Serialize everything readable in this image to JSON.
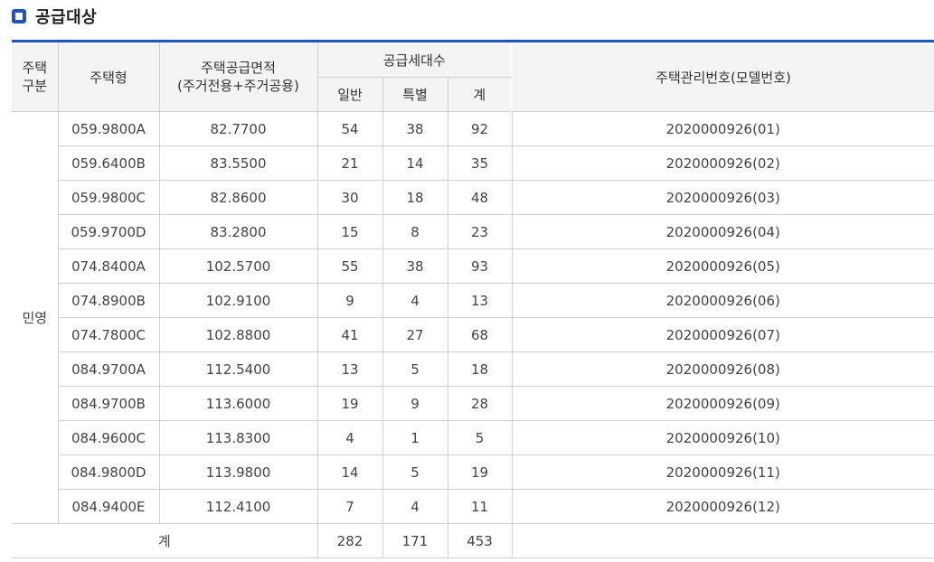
{
  "section_title": "공급대상",
  "headers": {
    "house_category": [
      "주택",
      "구분"
    ],
    "house_type": "주택형",
    "area": [
      "주택공급면적",
      "(주거전용+주거공용)"
    ],
    "supply_count": "공급세대수",
    "general": "일반",
    "special": "특별",
    "total": "계",
    "management_no": "주택관리번호(모델번호)"
  },
  "category": "민영",
  "rows": [
    {
      "type": "059.9800A",
      "area": "82.7700",
      "general": "54",
      "special": "38",
      "total": "92",
      "mgmt": "2020000926(01)"
    },
    {
      "type": "059.6400B",
      "area": "83.5500",
      "general": "21",
      "special": "14",
      "total": "35",
      "mgmt": "2020000926(02)"
    },
    {
      "type": "059.9800C",
      "area": "82.8600",
      "general": "30",
      "special": "18",
      "total": "48",
      "mgmt": "2020000926(03)"
    },
    {
      "type": "059.9700D",
      "area": "83.2800",
      "general": "15",
      "special": "8",
      "total": "23",
      "mgmt": "2020000926(04)"
    },
    {
      "type": "074.8400A",
      "area": "102.5700",
      "general": "55",
      "special": "38",
      "total": "93",
      "mgmt": "2020000926(05)"
    },
    {
      "type": "074.8900B",
      "area": "102.9100",
      "general": "9",
      "special": "4",
      "total": "13",
      "mgmt": "2020000926(06)"
    },
    {
      "type": "074.7800C",
      "area": "102.8800",
      "general": "41",
      "special": "27",
      "total": "68",
      "mgmt": "2020000926(07)"
    },
    {
      "type": "084.9700A",
      "area": "112.5400",
      "general": "13",
      "special": "5",
      "total": "18",
      "mgmt": "2020000926(08)"
    },
    {
      "type": "084.9700B",
      "area": "113.6000",
      "general": "19",
      "special": "9",
      "total": "28",
      "mgmt": "2020000926(09)"
    },
    {
      "type": "084.9600C",
      "area": "113.8300",
      "general": "4",
      "special": "1",
      "total": "5",
      "mgmt": "2020000926(10)"
    },
    {
      "type": "084.9800D",
      "area": "113.9800",
      "general": "14",
      "special": "5",
      "total": "19",
      "mgmt": "2020000926(11)"
    },
    {
      "type": "084.9400E",
      "area": "112.4100",
      "general": "7",
      "special": "4",
      "total": "11",
      "mgmt": "2020000926(12)"
    }
  ],
  "summary": {
    "label": "계",
    "general": "282",
    "special": "171",
    "total": "453",
    "mgmt": ""
  },
  "colors": {
    "accent": "#1f56b6",
    "header_bg": "#f4f4f4",
    "border": "#cfcfcf"
  }
}
